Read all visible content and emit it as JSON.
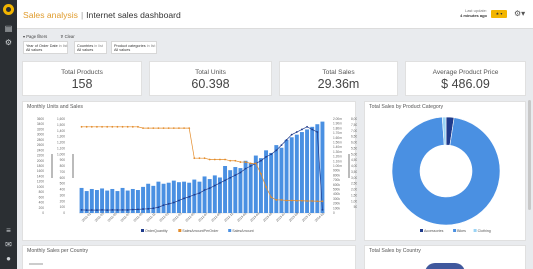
{
  "topbar": {
    "breadcrumb_root": "Sales analysis",
    "separator": "|",
    "title": "Internet sales dashboard",
    "update_label": "Last update:",
    "update_value": "4 minutes ago",
    "action_button": "★ ▾",
    "gear": "⚙▾"
  },
  "filters": {
    "toggle_label": "Page filters",
    "clear_label": "Clear",
    "chips": [
      {
        "name": "Year of Order Date",
        "op": "in list",
        "value": "All values"
      },
      {
        "name": "Countries",
        "op": "in list",
        "value": "All values"
      },
      {
        "name": "Product categories",
        "op": "in list",
        "value": "All values"
      }
    ]
  },
  "kpis": [
    {
      "label": "Total Products",
      "value": "158"
    },
    {
      "label": "Total Units",
      "value": "60.398"
    },
    {
      "label": "Total Sales",
      "value": "29.36m"
    },
    {
      "label": "Average Product Price",
      "value": "$ 486.09"
    }
  ],
  "panels": {
    "monthly": "Monthly Units and Sales",
    "category": "Total Sales by Product Category",
    "country_monthly": "Monthly Sales per Country",
    "country_total": "Total Sales by Country"
  },
  "chart_data": [
    {
      "type": "bar",
      "title": "Monthly Units and Sales",
      "categories": [
        "2011-01",
        "2011-03",
        "2011-05",
        "2011-07",
        "2011-09",
        "2011-11",
        "2012-01",
        "2012-03",
        "2012-05",
        "2012-07",
        "2012-09",
        "2012-11",
        "2013-01",
        "2013-03",
        "2013-05",
        "2013-07",
        "2013-09",
        "2013-11",
        "2014-01"
      ],
      "left_axis_ticks": [
        "3600",
        "3400",
        "3200",
        "3000",
        "2800",
        "2600",
        "2400",
        "2200",
        "2000",
        "1800",
        "1600",
        "1400",
        "1200",
        "1000",
        "800",
        "600",
        "400",
        "200",
        "0"
      ],
      "left2_axis_ticks": [
        "1,600",
        "1,500",
        "1,400",
        "1,300",
        "1,200",
        "1,100",
        "1,000",
        "900",
        "800",
        "700",
        "600",
        "500",
        "400",
        "300",
        "200",
        "100",
        "0"
      ],
      "right_axis_ticks": [
        "2.00m",
        "1.90m",
        "1.80m",
        "1.70m",
        "1.60m",
        "1.50m",
        "1.40m",
        "1.30m",
        "1.20m",
        "1.10m",
        "1.00m",
        "900k",
        "800k",
        "700k",
        "600k",
        "500k",
        "400k",
        "300k",
        "200k",
        "100k",
        "0"
      ],
      "right2_axis_ticks": [
        "8,000",
        "7,500",
        "7,000",
        "6,500",
        "6,000",
        "5,500",
        "5,000",
        "4,500",
        "4,000",
        "3,500",
        "3,000",
        "2,500",
        "2,000",
        "1,500",
        "1,000",
        "500",
        "0"
      ],
      "series": [
        {
          "name": "OrderQuantity",
          "color": "#1f3b8c",
          "values": [
            120,
            110,
            115,
            110,
            120,
            110,
            120,
            115,
            120,
            115,
            130,
            140,
            150,
            160,
            180,
            220,
            300,
            350,
            400,
            480,
            560,
            620,
            700,
            760,
            880,
            950,
            1050,
            1150,
            1250,
            1350,
            1450,
            1550,
            1700,
            1800,
            1900,
            2000,
            2150,
            2250,
            2400,
            2600,
            2800,
            3000,
            3100,
            3200,
            3300,
            3200,
            3100,
            120
          ]
        },
        {
          "name": "SalesAmountPerOrder",
          "color": "#e48c2a",
          "values": [
            3300,
            3300,
            3300,
            3300,
            3300,
            3300,
            3300,
            3300,
            3300,
            3300,
            3300,
            3300,
            3250,
            3250,
            3250,
            3250,
            3250,
            3250,
            3250,
            3250,
            3250,
            3250,
            2100,
            2100,
            2100,
            2050,
            2050,
            2050,
            2050,
            2000,
            2000,
            1950,
            1950,
            1900,
            1900,
            1500,
            1000,
            600,
            500,
            500,
            480,
            480,
            470,
            470,
            460,
            460,
            450,
            450
          ]
        },
        {
          "name": "SalesAmount",
          "color": "#4a90e2",
          "values": [
            480,
            420,
            460,
            440,
            470,
            430,
            460,
            420,
            480,
            430,
            460,
            440,
            500,
            560,
            520,
            600,
            560,
            580,
            620,
            590,
            600,
            580,
            640,
            600,
            700,
            650,
            720,
            680,
            900,
            820,
            880,
            860,
            1000,
            950,
            1100,
            1050,
            1200,
            1150,
            1300,
            1250,
            1400,
            1450,
            1500,
            1550,
            1600,
            1650,
            1700,
            1750
          ]
        }
      ]
    },
    {
      "type": "pie",
      "title": "Total Sales by Product Category",
      "categories": [
        "Accessories",
        "Bikes",
        "Clothing"
      ],
      "values": [
        2.4,
        96.5,
        1.1
      ],
      "colors": [
        "#1f3b8c",
        "#4a90e2",
        "#9bd4f5"
      ]
    }
  ],
  "colors": {
    "accent": "#f2b500",
    "nav_bg": "#2b2f33",
    "breadcrumb": "#e09c2e"
  }
}
